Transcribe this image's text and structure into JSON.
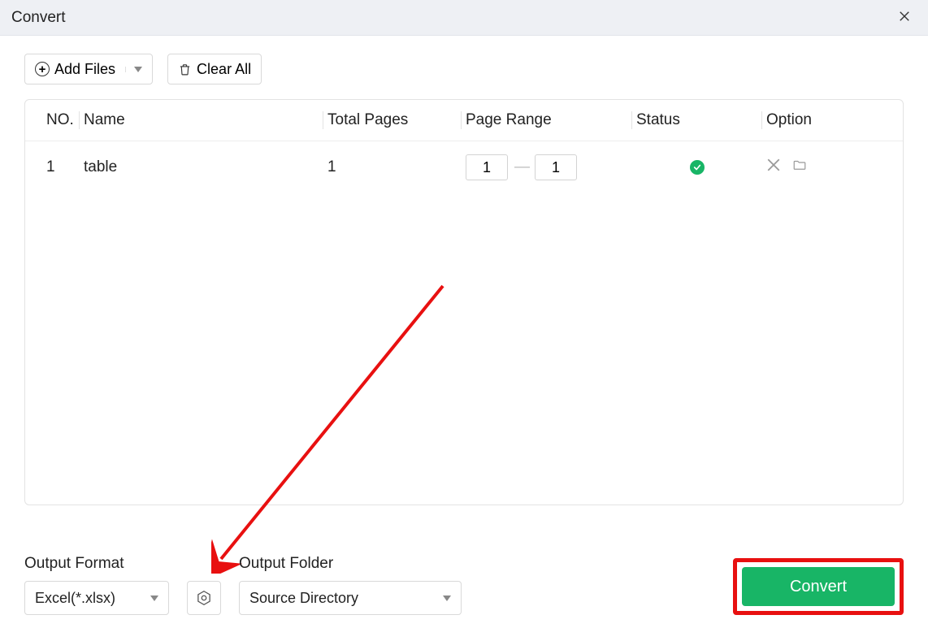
{
  "window": {
    "title": "Convert"
  },
  "toolbar": {
    "add_files_label": "Add Files",
    "clear_all_label": "Clear All"
  },
  "table": {
    "headers": {
      "no": "NO.",
      "name": "Name",
      "pages": "Total Pages",
      "range": "Page Range",
      "status": "Status",
      "option": "Option"
    },
    "rows": [
      {
        "no": "1",
        "name": "table",
        "pages": "1",
        "range_from": "1",
        "range_to": "1",
        "status": "ok"
      }
    ]
  },
  "footer": {
    "output_format_label": "Output Format",
    "output_format_value": "Excel(*.xlsx)",
    "output_folder_label": "Output Folder",
    "output_folder_value": "Source Directory",
    "convert_label": "Convert"
  }
}
